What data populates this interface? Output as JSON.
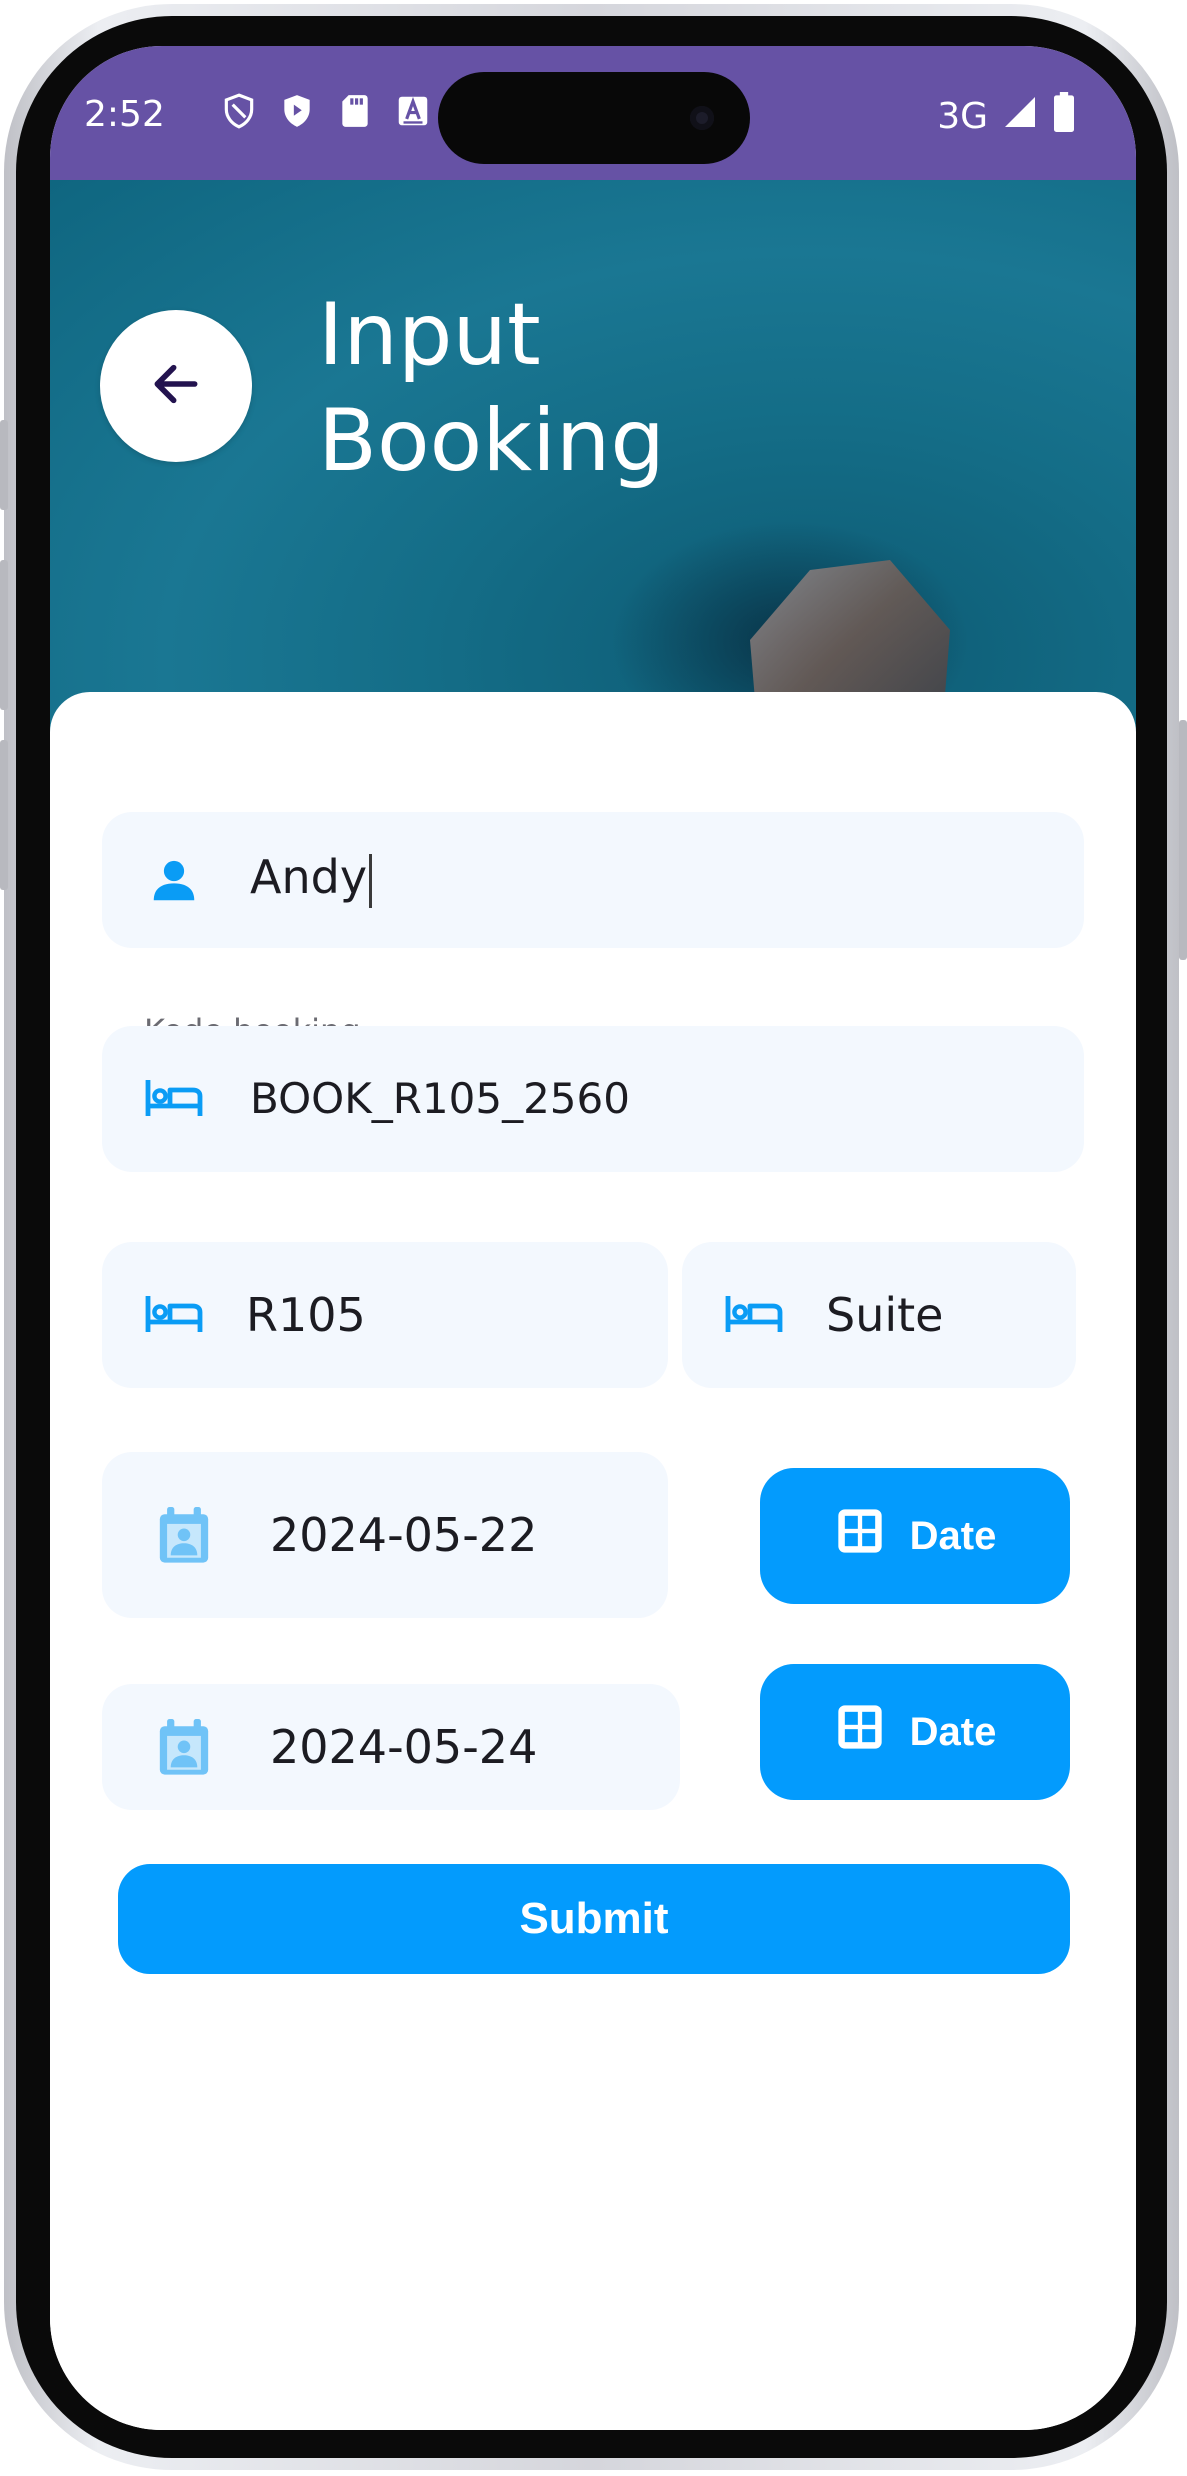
{
  "status_bar": {
    "time": "2:52",
    "network": "3G",
    "icons": [
      "shield-outline-icon",
      "shield-play-icon",
      "sd-card-icon",
      "font-icon",
      "signal-icon",
      "battery-icon"
    ]
  },
  "header": {
    "title_line1": "Input",
    "title_line2": "Booking",
    "back_icon": "arrow-left-icon"
  },
  "form": {
    "name": {
      "value": "Andy",
      "icon": "person-icon"
    },
    "booking_code": {
      "label": "Kode booking",
      "value": "BOOK_R105_2560",
      "icon": "bed-icon"
    },
    "room_number": {
      "value": "R105",
      "icon": "bed-icon"
    },
    "room_type": {
      "value": "Suite",
      "icon": "bed-icon"
    },
    "check_in": {
      "value": "2024-05-22",
      "icon": "calendar-person-icon",
      "button_label": "Date",
      "button_icon": "grid-icon"
    },
    "check_out": {
      "value": "2024-05-24",
      "icon": "calendar-person-icon",
      "button_label": "Date",
      "button_icon": "grid-icon"
    },
    "submit_label": "Submit"
  },
  "colors": {
    "status_bar": "#6652a5",
    "accent": "#039bfd",
    "field_bg": "#f3f8fe"
  }
}
